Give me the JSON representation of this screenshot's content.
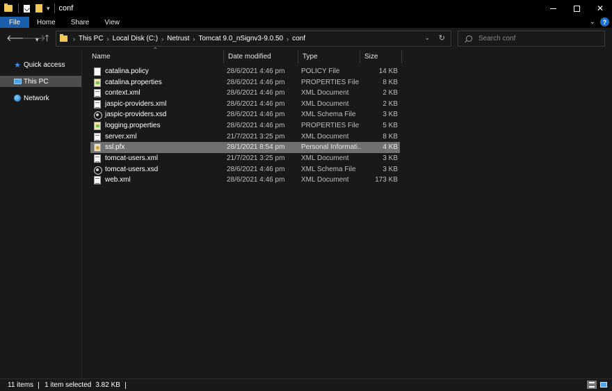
{
  "window": {
    "title": "conf",
    "controls": {
      "minimize": "minimize",
      "maximize": "maximize",
      "close": "✕"
    }
  },
  "ribbon": {
    "tabs": [
      "File",
      "Home",
      "Share",
      "View"
    ],
    "help": "?"
  },
  "address": {
    "breadcrumbs": [
      "This PC",
      "Local Disk (C:)",
      "Netrust",
      "Tomcat 9.0_nSignv3-9.0.50",
      "conf"
    ]
  },
  "search": {
    "placeholder": "Search conf"
  },
  "nav_pane": {
    "items": [
      {
        "label": "Quick access",
        "icon": "star-icon"
      },
      {
        "label": "This PC",
        "icon": "computer-icon",
        "selected": true
      },
      {
        "label": "Network",
        "icon": "network-icon"
      }
    ]
  },
  "columns": {
    "name": "Name",
    "date": "Date modified",
    "type": "Type",
    "size": "Size"
  },
  "files": [
    {
      "name": "catalina.policy",
      "date": "28/6/2021 4:46 pm",
      "type": "POLICY File",
      "size": "14 KB",
      "icon": "doc"
    },
    {
      "name": "catalina.properties",
      "date": "28/6/2021 4:46 pm",
      "type": "PROPERTIES File",
      "size": "8 KB",
      "icon": "prop"
    },
    {
      "name": "context.xml",
      "date": "28/6/2021 4:46 pm",
      "type": "XML Document",
      "size": "2 KB",
      "icon": "xml"
    },
    {
      "name": "jaspic-providers.xml",
      "date": "28/6/2021 4:46 pm",
      "type": "XML Document",
      "size": "2 KB",
      "icon": "xml"
    },
    {
      "name": "jaspic-providers.xsd",
      "date": "28/6/2021 4:46 pm",
      "type": "XML Schema File",
      "size": "3 KB",
      "icon": "xsd"
    },
    {
      "name": "logging.properties",
      "date": "28/6/2021 4:46 pm",
      "type": "PROPERTIES File",
      "size": "5 KB",
      "icon": "prop"
    },
    {
      "name": "server.xml",
      "date": "21/7/2021 3:25 pm",
      "type": "XML Document",
      "size": "8 KB",
      "icon": "xml"
    },
    {
      "name": "ssl.pfx",
      "date": "28/1/2021 8:54 pm",
      "type": "Personal Informati...",
      "size": "4 KB",
      "icon": "pfx",
      "selected": true
    },
    {
      "name": "tomcat-users.xml",
      "date": "21/7/2021 3:25 pm",
      "type": "XML Document",
      "size": "3 KB",
      "icon": "xml"
    },
    {
      "name": "tomcat-users.xsd",
      "date": "28/6/2021 4:46 pm",
      "type": "XML Schema File",
      "size": "3 KB",
      "icon": "xsd"
    },
    {
      "name": "web.xml",
      "date": "28/6/2021 4:46 pm",
      "type": "XML Document",
      "size": "173 KB",
      "icon": "xml"
    }
  ],
  "status": {
    "items": "11 items",
    "selected": "1 item selected",
    "size": "3.82 KB"
  },
  "colors": {
    "accent": "#1b5faa",
    "background": "#191919",
    "selection": "#707070",
    "folder": "#f0c85a"
  }
}
